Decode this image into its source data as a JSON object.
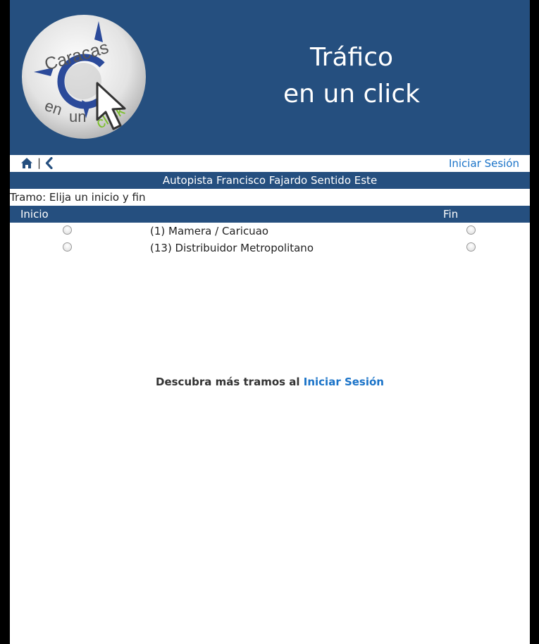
{
  "header": {
    "logo": {
      "text_top": "Caracas",
      "text_en": "en",
      "text_un": "un",
      "text_click": "click"
    },
    "title_line1": "Tráfico",
    "title_line2": "en un click"
  },
  "nav": {
    "home_icon": "home-icon",
    "separator": "|",
    "back_icon": "chevron-left-icon",
    "login_label": "Iniciar Sesión"
  },
  "road_title": "Autopista Francisco Fajardo Sentido Este",
  "tramo_label": "Tramo: Elija un inicio y fin",
  "columns": {
    "start": "Inicio",
    "end": "Fin"
  },
  "segments": [
    {
      "label": "(1) Mamera / Caricuao"
    },
    {
      "label": "(13) Distribuidor Metropolitano"
    }
  ],
  "discover": {
    "text": "Descubra más tramos al ",
    "link": "Iniciar Sesión"
  },
  "colors": {
    "brand_blue": "#254f7f",
    "link_blue": "#1a73c8",
    "logo_green": "#7bbf2a"
  }
}
